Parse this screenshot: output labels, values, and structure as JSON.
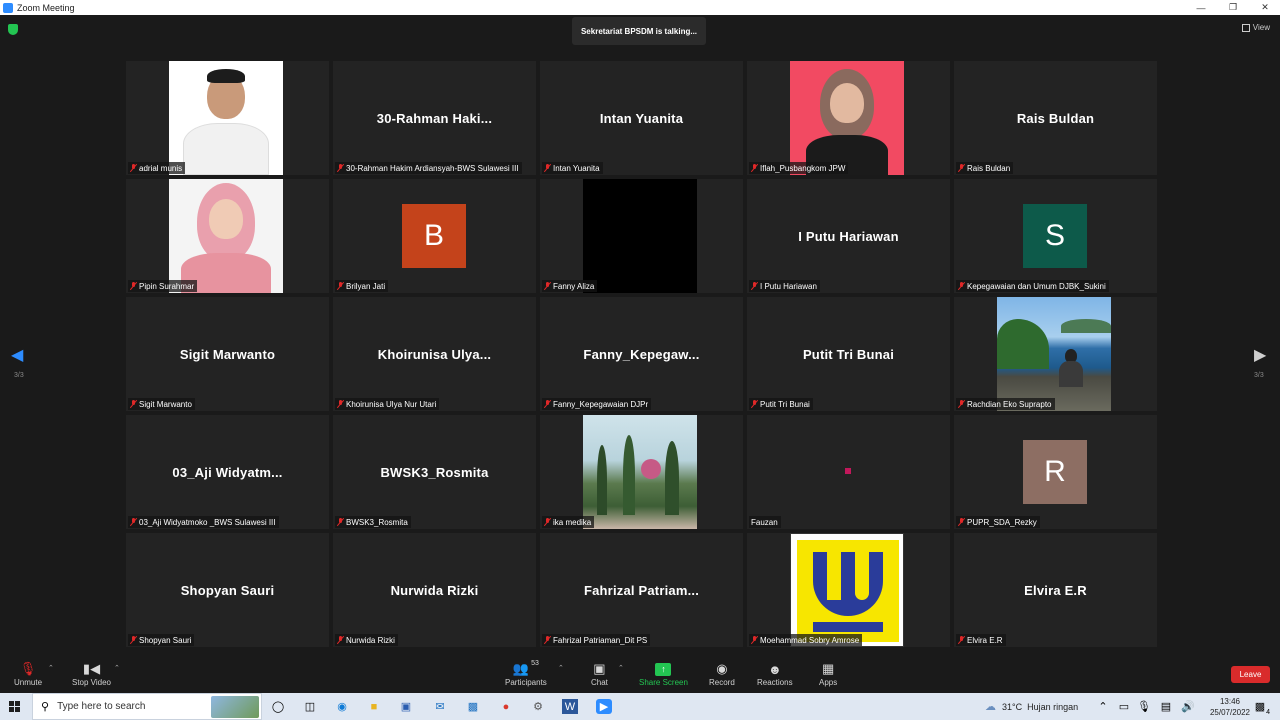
{
  "window": {
    "title": "Zoom Meeting"
  },
  "meeting": {
    "talking_indicator": "Sekretariat BPSDM is talking...",
    "view_label": "View",
    "page_left": "3/3",
    "page_right": "3/3"
  },
  "tiles": [
    {
      "display": "",
      "label": "adrial munis",
      "muted": true,
      "kind": "photo-man"
    },
    {
      "display": "30-Rahman  Haki...",
      "label": "30-Rahman Hakim Ardiansyah-BWS Sulawesi III",
      "muted": true,
      "kind": "name"
    },
    {
      "display": "Intan Yuanita",
      "label": "Intan Yuanita",
      "muted": true,
      "kind": "name"
    },
    {
      "display": "",
      "label": "Iflah_Pusbangkom JPW",
      "muted": true,
      "kind": "photo-woman-red"
    },
    {
      "display": "Rais Buldan",
      "label": "Rais Buldan",
      "muted": true,
      "kind": "name"
    },
    {
      "display": "",
      "label": "Pipin Surahmar",
      "muted": true,
      "kind": "photo-woman-white"
    },
    {
      "display": "B",
      "label": "Brilyan Jati",
      "muted": true,
      "kind": "avatar",
      "color": "#c4431b"
    },
    {
      "display": "",
      "label": "Fanny Aliza",
      "muted": true,
      "kind": "black"
    },
    {
      "display": "I Putu Hariawan",
      "label": "I Putu Hariawan",
      "muted": true,
      "kind": "name"
    },
    {
      "display": "S",
      "label": "Kepegawaian dan Umum DJBK_Sukini",
      "muted": true,
      "kind": "avatar",
      "color": "#0d5a4a"
    },
    {
      "display": "Sigit Marwanto",
      "label": "Sigit Marwanto",
      "muted": true,
      "kind": "name"
    },
    {
      "display": "Khoirunisa  Ulya...",
      "label": "Khoirunisa Ulya Nur Utari",
      "muted": true,
      "kind": "name"
    },
    {
      "display": "Fanny_Kepegaw...",
      "label": "Fanny_Kepegawaian DJPr",
      "muted": true,
      "kind": "name"
    },
    {
      "display": "Putit Tri Bunai",
      "label": "Putit Tri Bunai",
      "muted": true,
      "kind": "name"
    },
    {
      "display": "",
      "label": "Rachdian Eko Suprapto",
      "muted": true,
      "kind": "photo-beach"
    },
    {
      "display": "03_Aji  Widyatm...",
      "label": "03_Aji Widyatmoko _BWS Sulawesi III",
      "muted": true,
      "kind": "name"
    },
    {
      "display": "BWSK3_Rosmita",
      "label": "BWSK3_Rosmita",
      "muted": true,
      "kind": "name"
    },
    {
      "display": "",
      "label": "ika medika",
      "muted": true,
      "kind": "photo-garden"
    },
    {
      "display": "",
      "label": "Fauzan",
      "muted": false,
      "kind": "dot"
    },
    {
      "display": "R",
      "label": "PUPR_SDA_Rezky",
      "muted": true,
      "kind": "avatar",
      "color": "#8d6e63"
    },
    {
      "display": "Shopyan Sauri",
      "label": "Shopyan Sauri",
      "muted": true,
      "kind": "name"
    },
    {
      "display": "Nurwida Rizki",
      "label": "Nurwida Rizki",
      "muted": true,
      "kind": "name"
    },
    {
      "display": "Fahrizal  Patriam...",
      "label": "Fahrizal Patriaman_Dit PS",
      "muted": true,
      "kind": "name"
    },
    {
      "display": "",
      "label": "Moehammad Sobry Amrose",
      "muted": true,
      "kind": "logo-pu"
    },
    {
      "display": "Elvira E.R",
      "label": "Elvira E.R",
      "muted": true,
      "kind": "name"
    }
  ],
  "toolbar": {
    "unmute": "Unmute",
    "stop_video": "Stop Video",
    "participants": "Participants",
    "participants_count": "53",
    "chat": "Chat",
    "share_screen": "Share Screen",
    "record": "Record",
    "reactions": "Reactions",
    "apps": "Apps",
    "leave": "Leave"
  },
  "taskbar": {
    "search_placeholder": "Type here to search",
    "temperature": "31°C",
    "weather": "Hujan ringan",
    "time": "13:46",
    "date": "25/07/2022",
    "notification_count": "4"
  },
  "colors": {
    "share_green": "#23c552",
    "leave_red": "#d92b2b",
    "arrow_blue": "#2d8cff"
  }
}
